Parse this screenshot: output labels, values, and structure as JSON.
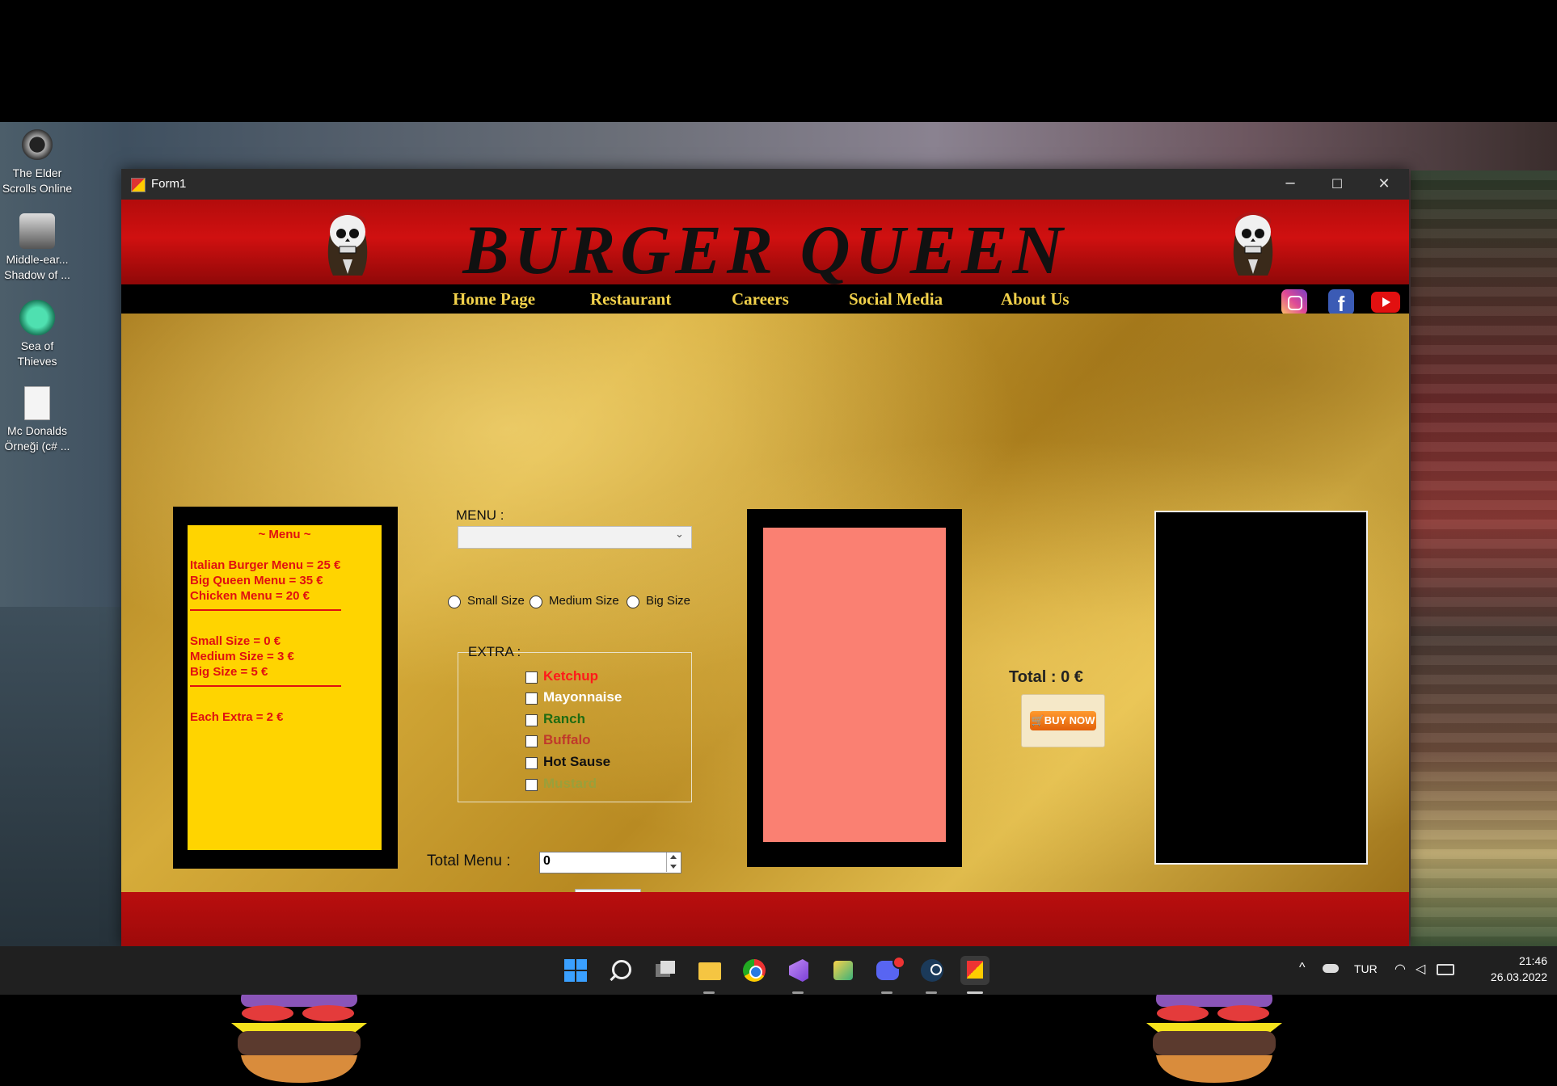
{
  "desktop": {
    "icons": [
      {
        "label1": "The Elder",
        "label2": "Scrolls Online"
      },
      {
        "label1": "Middle-ear...",
        "label2": "Shadow of ..."
      },
      {
        "label1": "Sea of",
        "label2": "Thieves"
      },
      {
        "label1": "Mc Donalds",
        "label2": "Örneği (c# ..."
      }
    ]
  },
  "window": {
    "title": "Form1",
    "minimize": "─",
    "maximize": "☐",
    "close": "✕"
  },
  "header": {
    "brand": "BURGER QUEEN",
    "nav": [
      "Home Page",
      "Restaurant",
      "Careers",
      "Social Media",
      "About Us"
    ],
    "social": [
      "instagram-icon",
      "facebook-icon",
      "youtube-icon"
    ]
  },
  "menu_board": {
    "title": "~ Menu ~",
    "menus": [
      "Italian Burger Menu = 25 €",
      "Big Queen Menu = 35 €",
      "Chicken Menu = 20 €"
    ],
    "sizes": [
      "Small Size = 0 €",
      "Medium Size = 3 €",
      "Big Size = 5 €"
    ],
    "extra": "Each Extra = 2 €"
  },
  "order": {
    "menu_label": "MENU :",
    "menu_selected": "",
    "size_options": [
      "Small Size",
      "Medium Size",
      "Big Size"
    ],
    "extra_label": "EXTRA :",
    "extras": [
      {
        "label": "Ketchup",
        "color": "#ff1a1a"
      },
      {
        "label": "Mayonnaise",
        "color": "#ffffff"
      },
      {
        "label": "Ranch",
        "color": "#1f6b12"
      },
      {
        "label": "Buffalo",
        "color": "#c0392b"
      },
      {
        "label": "Hot Sause",
        "color": "#111111"
      },
      {
        "label": "Mustard",
        "color": "#9aa03a"
      }
    ],
    "total_menu_label": "Total  Menu :",
    "total_menu_value": "0",
    "total_label": "Total :  0 €",
    "buy_label": "BUY NOW"
  },
  "taskbar": {
    "lang": "TUR",
    "time": "21:46",
    "date": "26.03.2022"
  }
}
